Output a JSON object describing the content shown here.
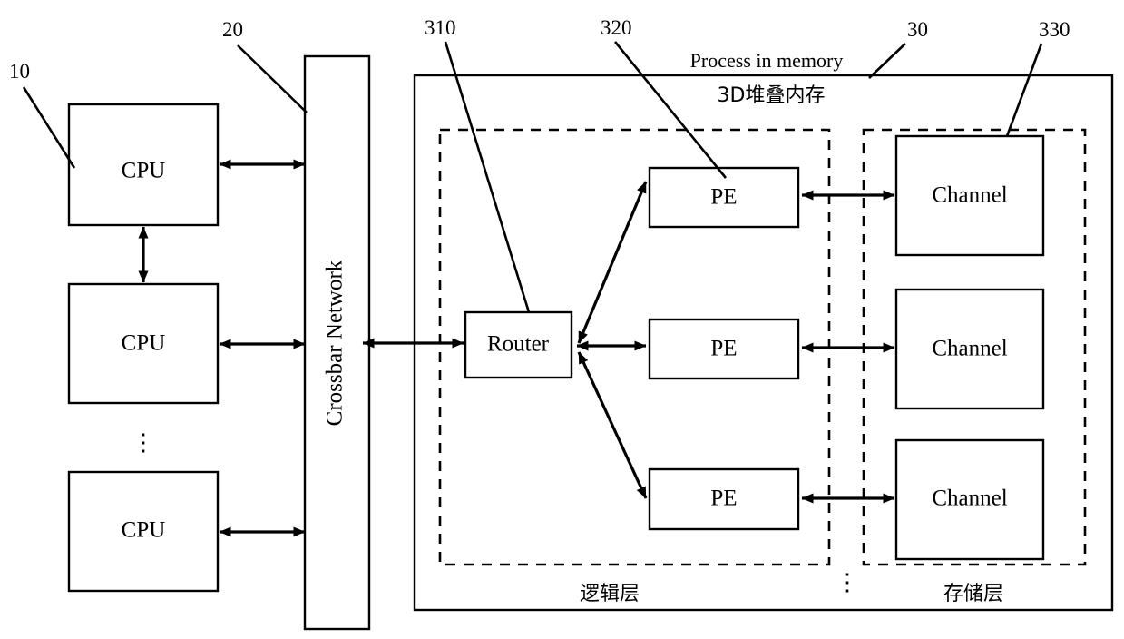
{
  "figure": {
    "title_above_box": "Process in memory",
    "inner_title": "3D堆叠内存"
  },
  "reference_numbers": {
    "cpu_group": "10",
    "crossbar": "20",
    "pim": "30",
    "router": "310",
    "pe": "320",
    "channel": "330"
  },
  "cpu_column": {
    "items": [
      {
        "label": "CPU"
      },
      {
        "label": "CPU"
      },
      {
        "label": "CPU"
      }
    ],
    "ellipsis": "⋮"
  },
  "crossbar": {
    "label": "Crossbar Network"
  },
  "logic_layer": {
    "caption": "逻辑层",
    "router": {
      "label": "Router"
    },
    "pes": [
      {
        "label": "PE"
      },
      {
        "label": "PE"
      },
      {
        "label": "PE"
      }
    ]
  },
  "memory_layer": {
    "caption": "存储层",
    "channels": [
      {
        "label": "Channel"
      },
      {
        "label": "Channel"
      },
      {
        "label": "Channel"
      }
    ],
    "ellipsis": "⋮"
  },
  "colors": {
    "stroke": "#000000",
    "background": "#ffffff"
  }
}
